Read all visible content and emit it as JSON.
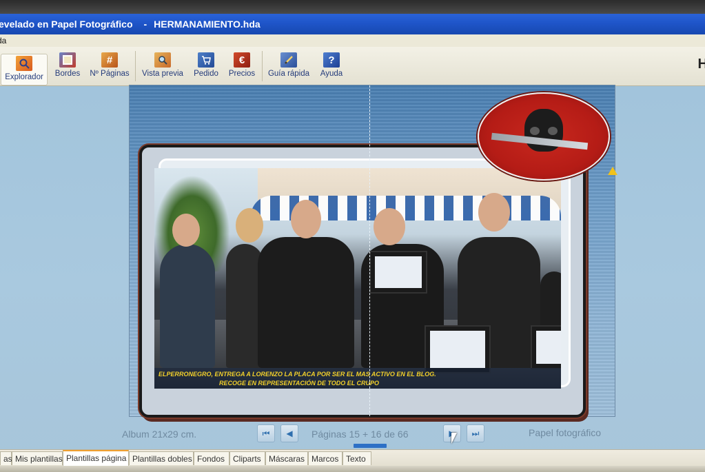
{
  "window": {
    "app_title": "evelado en Papel Fotográfico",
    "separator": "-",
    "document_title": "HERMANAMIENTO.hda"
  },
  "menubar": {
    "partial_item": "da"
  },
  "toolbar": {
    "buttons": [
      {
        "label": "Explorador",
        "icon": "explorer-icon",
        "active": true
      },
      {
        "label": "Bordes",
        "icon": "borders-icon"
      },
      {
        "label": "Nº Páginas",
        "icon": "page-count-icon"
      },
      {
        "label": "Vista previa",
        "icon": "preview-icon"
      },
      {
        "label": "Pedido",
        "icon": "order-icon"
      },
      {
        "label": "Precios",
        "icon": "euro-icon"
      },
      {
        "label": "Guía rápida",
        "icon": "quick-guide-icon"
      },
      {
        "label": "Ayuda",
        "icon": "help-icon"
      }
    ],
    "right_glyph": "H",
    "icon_glyphs": {
      "page_count": "#",
      "price": "€",
      "help": "?"
    }
  },
  "spread": {
    "caption_line1": "ELPERRONEGRO, ENTREGA A LORENZO LA PLACA POR SER EL MAS ACTIVO EN EL BLOG.",
    "caption_line2": "RECOGE EN REPRESENTACIÓN DE TODO EL CRUPO"
  },
  "navigation": {
    "album_size": "Album 21x29 cm.",
    "pages_label": "Páginas 15 + 16 de 66",
    "paper_type": "Papel fotográfico",
    "first_glyph": "⏮",
    "prev_glyph": "◀",
    "next_glyph": "▶",
    "last_glyph": "⏭"
  },
  "tabs": [
    {
      "label": "as"
    },
    {
      "label": "Mis plantillas"
    },
    {
      "label": "Plantillas página",
      "active": true
    },
    {
      "label": "Plantillas dobles"
    },
    {
      "label": "Fondos"
    },
    {
      "label": "Cliparts"
    },
    {
      "label": "Máscaras"
    },
    {
      "label": "Marcos"
    },
    {
      "label": "Texto"
    }
  ],
  "colors": {
    "titlebar": "#1f55c9",
    "caption_text": "#f3d12a",
    "logo_red": "#c8281e",
    "active_tab_accent": "#f0a030"
  }
}
